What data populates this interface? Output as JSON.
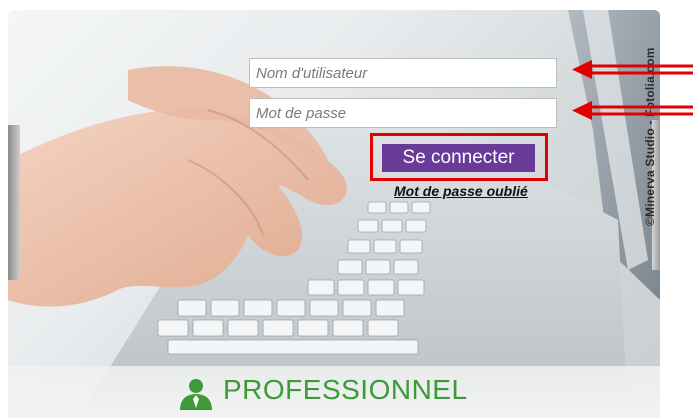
{
  "login": {
    "username_placeholder": "Nom d'utilisateur",
    "password_placeholder": "Mot de passe",
    "submit_label": "Se connecter",
    "forgot_label": "Mot de passe oublié"
  },
  "photo": {
    "credit": "©Minerva Studio - Fotolia.com"
  },
  "portal": {
    "label": "PROFESSIONNEL",
    "icon": "user-icon"
  },
  "colors": {
    "button": "#6a3a99",
    "annotation": "#e00000",
    "portal_green": "#3c9a3a"
  }
}
